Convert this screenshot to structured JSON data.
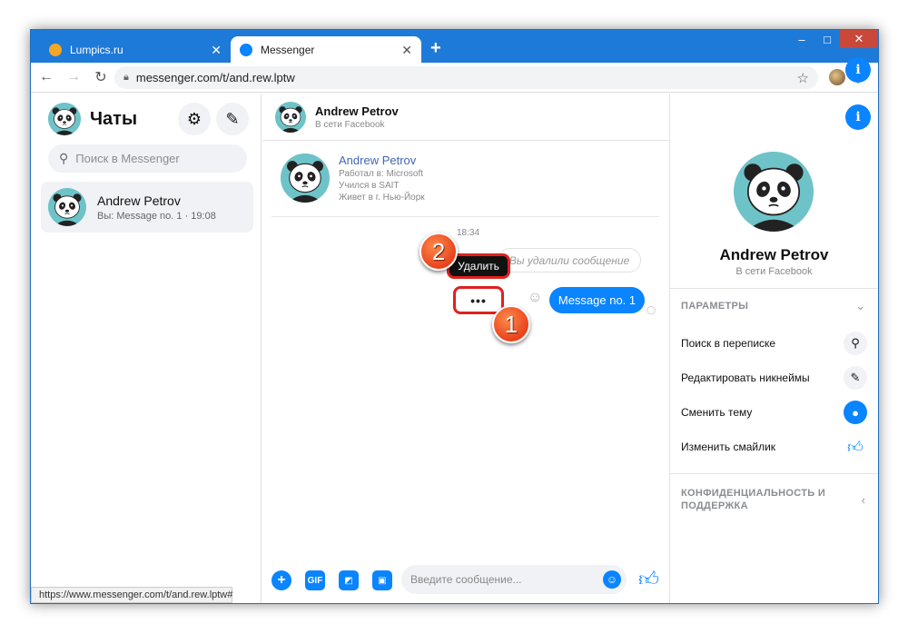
{
  "browser": {
    "tabs": [
      {
        "title": "Lumpics.ru",
        "active": false
      },
      {
        "title": "Messenger",
        "active": true
      }
    ],
    "new_tab": "+",
    "url": "messenger.com/t/and.rew.lptw",
    "status_url": "https://www.messenger.com/t/and.rew.lptw#",
    "window_controls": {
      "minimize": "–",
      "maximize": "□",
      "close": "✕"
    }
  },
  "sidebar": {
    "title": "Чаты",
    "search_placeholder": "Поиск в Messenger",
    "conversation": {
      "name": "Andrew Petrov",
      "preview": "Вы: Message no. 1 · 19:08"
    }
  },
  "chat": {
    "header": {
      "name": "Andrew Petrov",
      "status": "В сети Facebook"
    },
    "profile_card": {
      "name": "Andrew Petrov",
      "lines": [
        "Работал в: Microsoft",
        "Учился в SAIT",
        "Живет в г. Нью-Йорк"
      ]
    },
    "timestamp": "18:34",
    "deleted_message": "Вы удалили сообщение",
    "message": "Message no. 1",
    "more_button": "•••",
    "tooltip": "Удалить",
    "annotations": [
      "1",
      "2"
    ],
    "composer_placeholder": "Введите сообщение...",
    "gif_label": "GIF"
  },
  "info_panel": {
    "name": "Andrew Petrov",
    "status": "В сети Facebook",
    "section_params": "ПАРАМЕТРЫ",
    "rows": [
      "Поиск в переписке",
      "Редактировать никнеймы",
      "Сменить тему",
      "Изменить смайлик"
    ],
    "section_privacy_1": "КОНФИДЕНЦИАЛЬНОСТЬ И",
    "section_privacy_2": "ПОДДЕРЖКА"
  },
  "colors": {
    "accent": "#0a84ff",
    "titlebar": "#1e7ad8",
    "annotation": "#e0211e"
  }
}
